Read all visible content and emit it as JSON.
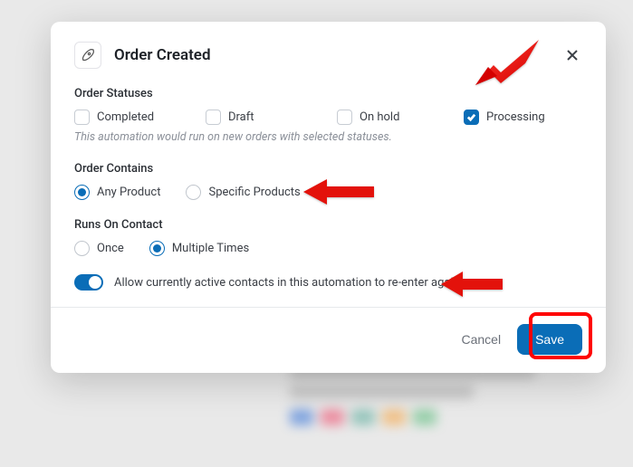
{
  "modal": {
    "title": "Order Created"
  },
  "statuses": {
    "label": "Order Statuses",
    "items": [
      {
        "label": "Completed",
        "checked": false
      },
      {
        "label": "Draft",
        "checked": false
      },
      {
        "label": "On hold",
        "checked": false
      },
      {
        "label": "Processing",
        "checked": true
      }
    ],
    "helper": "This automation would run on new orders with selected statuses."
  },
  "contains": {
    "label": "Order Contains",
    "options": [
      {
        "label": "Any Product",
        "selected": true
      },
      {
        "label": "Specific Products",
        "selected": false
      }
    ]
  },
  "runs": {
    "label": "Runs On Contact",
    "options": [
      {
        "label": "Once",
        "selected": false
      },
      {
        "label": "Multiple Times",
        "selected": true
      }
    ]
  },
  "reenter": {
    "label": "Allow currently active contacts in this automation to re-enter again",
    "enabled": true
  },
  "footer": {
    "cancel": "Cancel",
    "save": "Save"
  }
}
